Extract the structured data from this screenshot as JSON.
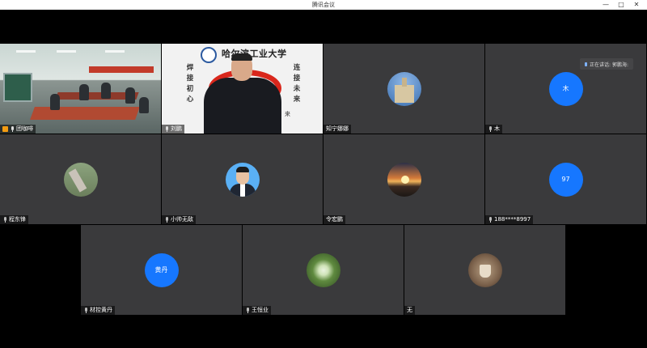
{
  "window": {
    "title": "腾讯会议",
    "controls": {
      "minimize": "—",
      "maximize": "□",
      "close": "✕"
    }
  },
  "speaking_indicator": {
    "label": "正在讲话: 郭鹏海:"
  },
  "participants": [
    {
      "id": "p1",
      "name": "团咖啡",
      "video": "classroom",
      "mic": "on",
      "host": true,
      "active": true
    },
    {
      "id": "p2",
      "name": "刘鹏",
      "video": "speaker",
      "mic": "on",
      "host": false
    },
    {
      "id": "p3",
      "name": "知宁娜娜",
      "video": "avatar-photo",
      "mic": "none",
      "host": false
    },
    {
      "id": "p4",
      "name": "木",
      "video": "avatar-text",
      "avatar_text": "木",
      "mic": "muted",
      "host": false
    },
    {
      "id": "p5",
      "name": "程东锋",
      "video": "avatar-photo",
      "mic": "muted",
      "host": false
    },
    {
      "id": "p6",
      "name": "小帅无敌",
      "video": "avatar-photo",
      "mic": "muted",
      "host": false
    },
    {
      "id": "p7",
      "name": "令宏鹏",
      "video": "avatar-photo",
      "mic": "none",
      "host": false
    },
    {
      "id": "p8",
      "name": "188****8997",
      "video": "avatar-text",
      "avatar_text": "97",
      "mic": "muted",
      "host": false
    },
    {
      "id": "p9",
      "name": "材控黄丹",
      "video": "avatar-text",
      "avatar_text": "黄丹",
      "mic": "muted",
      "host": false
    },
    {
      "id": "p10",
      "name": "王恒业",
      "video": "avatar-photo",
      "mic": "muted",
      "host": false
    },
    {
      "id": "p11",
      "name": "无",
      "video": "avatar-photo",
      "mic": "none",
      "host": false
    }
  ],
  "speaker_backdrop": {
    "university": "哈尔滨工业大学",
    "left_slogan": "焊接初心",
    "right_slogan": "连接未来",
    "tail": "来"
  },
  "colors": {
    "tile_bg": "#3a3a3c",
    "avatar_blue": "#1677ff",
    "active_border": "#3db24a",
    "host_badge": "#f39c12"
  }
}
